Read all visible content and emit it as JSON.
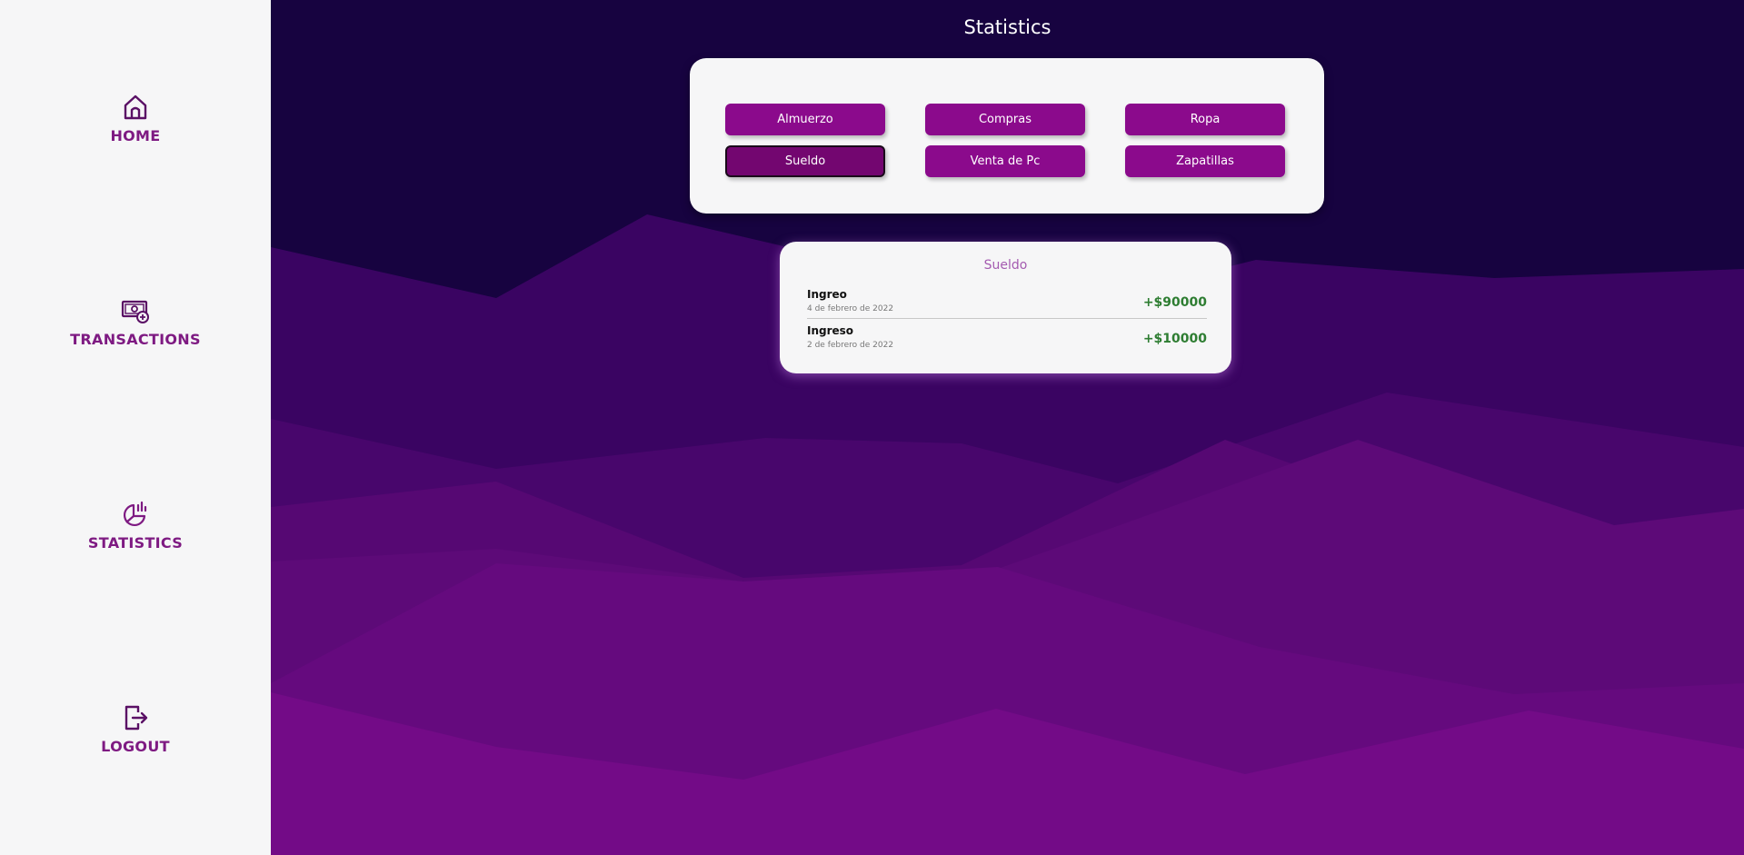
{
  "sidebar": {
    "items": [
      {
        "label": "HOME",
        "icon": "home-icon"
      },
      {
        "label": "TRANSACTIONS",
        "icon": "money-add-icon"
      },
      {
        "label": "STATISTICS",
        "icon": "chart-pie-icon"
      },
      {
        "label": "LOGOUT",
        "icon": "logout-icon"
      }
    ]
  },
  "main": {
    "title": "Statistics",
    "categories": [
      "Almuerzo",
      "Compras",
      "Ropa",
      "Sueldo",
      "Venta de Pc",
      "Zapatillas"
    ],
    "selected_category": "Sueldo",
    "detail": {
      "title": "Sueldo",
      "transactions": [
        {
          "type": "Ingreo",
          "date": "4 de febrero de 2022",
          "amount": "+$90000"
        },
        {
          "type": "Ingreso",
          "date": "2 de febrero de 2022",
          "amount": "+$10000"
        }
      ]
    }
  },
  "colors": {
    "accent": "#8b0a8c",
    "accent_active": "#730670",
    "nav_text": "#7e1a82",
    "income": "#2e7d32",
    "background_dark": "#170340"
  }
}
